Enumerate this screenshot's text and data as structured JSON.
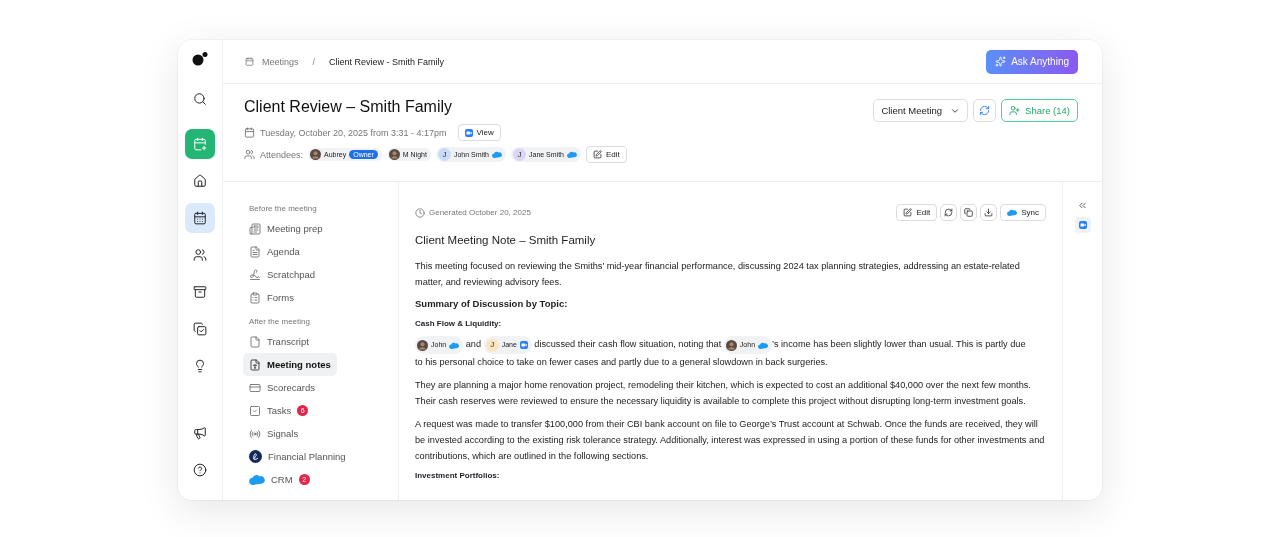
{
  "rail": {
    "top": [
      {
        "kind": "search",
        "selected": false
      },
      {
        "kind": "action",
        "selected": false
      },
      {
        "kind": "nav",
        "selected": false
      },
      {
        "kind": "nav",
        "selected": true
      },
      {
        "kind": "nav",
        "selected": false
      },
      {
        "kind": "nav",
        "selected": false
      },
      {
        "kind": "nav",
        "selected": false
      },
      {
        "kind": "nav",
        "selected": false
      }
    ],
    "bottom": [
      {
        "kind": "nav",
        "selected": false
      },
      {
        "kind": "nav",
        "selected": false
      }
    ]
  },
  "breadcrumb": [
    {
      "label": "Meetings",
      "current": false
    },
    {
      "label": "Client Review - Smith Family",
      "current": true
    }
  ],
  "breadcrumb_separator": "/",
  "ask_button": "Ask Anything",
  "meeting": {
    "title": "Client Review – Smith Family",
    "date": "Tuesday, October 20, 2025 from 3:31 - 4:17pm",
    "view_button": "View",
    "type_select": "Client Meeting",
    "share_button": "Share (14)",
    "attendees_label": "Attendees:",
    "edit_button": "Edit",
    "attendees": [
      {
        "name": "Aubrey",
        "photo": true,
        "badge": "Owner",
        "crm_linked": false
      },
      {
        "name": "M Night",
        "photo": true,
        "crm_linked": false
      },
      {
        "name": "John Smith",
        "photo": false,
        "initial": "J",
        "color": "#c9dcf7",
        "crm_linked": true
      },
      {
        "name": "Jane Smith",
        "photo": false,
        "initial": "J",
        "color": "#dcd6f5",
        "crm_linked": true
      }
    ]
  },
  "nav": {
    "sections": [
      {
        "title": "Before the meeting",
        "items": [
          {
            "label": "Meeting prep",
            "selected": false
          },
          {
            "label": "Agenda",
            "selected": false
          },
          {
            "label": "Scratchpad",
            "selected": false
          },
          {
            "label": "Forms",
            "selected": false
          }
        ]
      },
      {
        "title": "After the meeting",
        "items": [
          {
            "label": "Transcript",
            "selected": false
          },
          {
            "label": "Meeting notes",
            "selected": true
          },
          {
            "label": "Scorecards",
            "selected": false
          },
          {
            "label": "Tasks",
            "selected": false,
            "count": "6"
          },
          {
            "label": "Signals",
            "selected": false
          },
          {
            "label": "Financial Planning",
            "selected": false
          },
          {
            "label": "CRM",
            "selected": false,
            "count": "2"
          }
        ]
      }
    ]
  },
  "note": {
    "generated": "Generated October 20, 2025",
    "toolbar": {
      "edit": "Edit",
      "sync": "Sync"
    },
    "title": "Client Meeting Note – Smith Family",
    "blocks": [
      {
        "kind": "paragraph",
        "segments": [
          {
            "kind": "text",
            "text": "This meeting focused on reviewing the Smiths’ mid-year financial performance, discussing 2024 tax planning strategies, addressing an estate-related matter, and reviewing advisory fees."
          }
        ]
      },
      {
        "kind": "heading",
        "text": "Summary of Discussion by Topic:"
      },
      {
        "kind": "subheading",
        "text": "Cash Flow & Liquidity:"
      },
      {
        "kind": "paragraph",
        "segments": [
          {
            "kind": "mention",
            "name": "John",
            "photo": true,
            "crm_linked": true,
            "in_meeting": false
          },
          {
            "kind": "text",
            "text": " and "
          },
          {
            "kind": "mention",
            "name": "Jane",
            "photo": false,
            "initial": "J",
            "color": "#fbe6c4",
            "crm_linked": false,
            "in_meeting": true
          },
          {
            "kind": "text",
            "text": " discussed their cash flow situation, noting that "
          },
          {
            "kind": "mention",
            "name": "John",
            "photo": true,
            "crm_linked": true,
            "in_meeting": false
          },
          {
            "kind": "text",
            "text": "’s income has been slightly lower than usual. This is partly due"
          },
          {
            "kind": "line",
            "text": "to his personal choice to take on fewer cases and partly due to a general slowdown in back surgeries."
          }
        ]
      },
      {
        "kind": "paragraph",
        "segments": [
          {
            "kind": "text",
            "text": "They are planning a major home renovation project, remodeling their kitchen, which is expected to cost an additional $40,000 over the next few months. Their cash reserves were reviewed to ensure the necessary liquidity is available to complete this project without disrupting long-term investment goals."
          }
        ]
      },
      {
        "kind": "paragraph",
        "segments": [
          {
            "kind": "text",
            "text": "A request was made to transfer $100,000 from their CBI bank account on file to George’s Trust account at Schwab. Once the funds are received, they will be invested according to the existing risk tolerance strategy. Additionally, interest was expressed in using a portion of these funds for other investments and contributions, which are outlined in the following sections."
          }
        ]
      },
      {
        "kind": "subheading",
        "text": "Investment Portfolios:"
      }
    ]
  }
}
